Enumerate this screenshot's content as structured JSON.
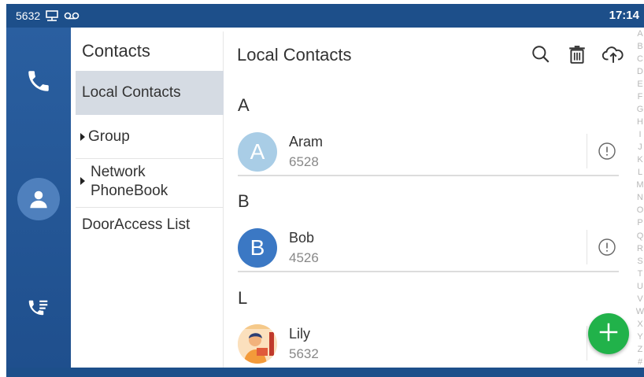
{
  "statusbar": {
    "extension": "5632",
    "time": "17:14",
    "icons": [
      "network-icon",
      "voicemail-icon"
    ]
  },
  "nav": {
    "items": [
      {
        "name": "phone",
        "icon": "phone-icon"
      },
      {
        "name": "contacts",
        "icon": "contact-person-icon",
        "active": true
      },
      {
        "name": "history",
        "icon": "call-history-icon"
      }
    ]
  },
  "menu": {
    "title": "Contacts",
    "items": [
      {
        "label": "Local Contacts",
        "active": true
      },
      {
        "label": "Group",
        "expandable": true
      },
      {
        "label": "Network PhoneBook",
        "line1": "Network",
        "line2": "PhoneBook",
        "expandable": true
      },
      {
        "label": "DoorAccess List"
      }
    ]
  },
  "main": {
    "title": "Local Contacts",
    "toolbar": [
      "search-icon",
      "trash-icon",
      "cloud-upload-icon"
    ],
    "sections": [
      {
        "letter": "A",
        "contacts": [
          {
            "name": "Aram",
            "number": "6528",
            "initial": "A",
            "color": "#a9cde6"
          }
        ]
      },
      {
        "letter": "B",
        "contacts": [
          {
            "name": "Bob",
            "number": "4526",
            "initial": "B",
            "color": "#3b78c4"
          }
        ]
      },
      {
        "letter": "L",
        "contacts": [
          {
            "name": "Lily",
            "number": "5632",
            "initial": "",
            "color": "#f2a24a"
          }
        ]
      }
    ]
  },
  "alphabet": [
    "A",
    "B",
    "C",
    "D",
    "E",
    "F",
    "G",
    "H",
    "I",
    "J",
    "K",
    "L",
    "M",
    "N",
    "O",
    "P",
    "Q",
    "R",
    "S",
    "T",
    "U",
    "V",
    "W",
    "X",
    "Y",
    "Z",
    "#"
  ],
  "colors": {
    "bar": "#1d4f8a",
    "rail": "#2a5fa0",
    "fab": "#21b24a",
    "active_menu": "#d5dbe3"
  }
}
